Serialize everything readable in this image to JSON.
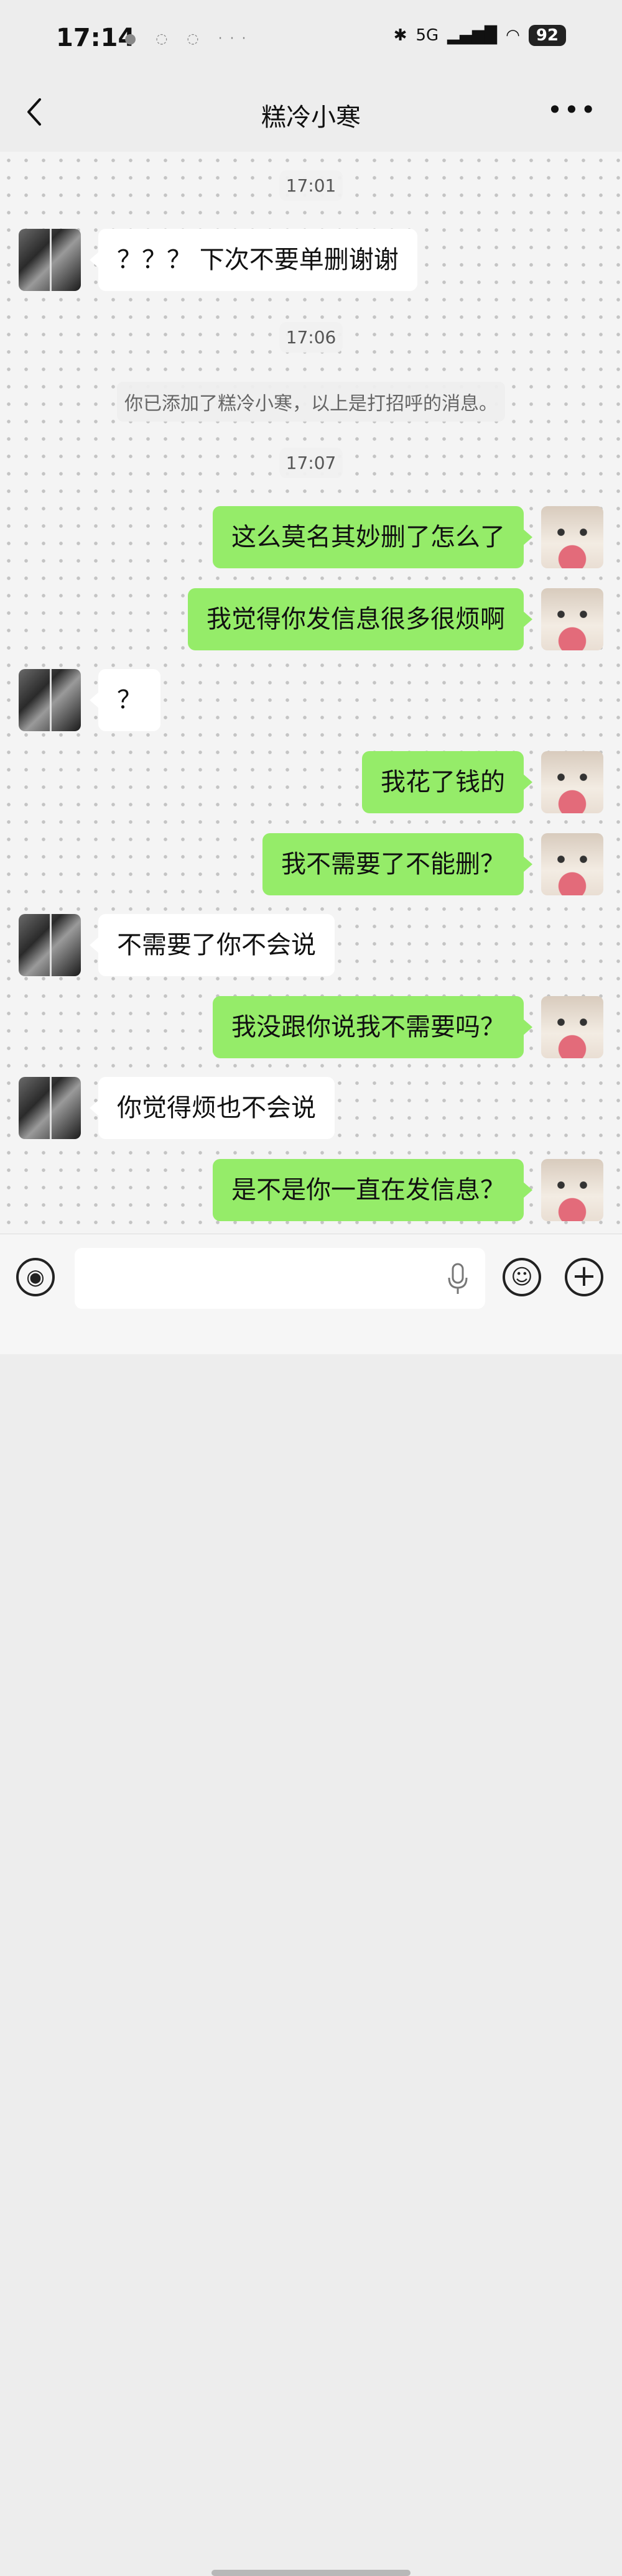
{
  "status_bar": {
    "time": "17:14",
    "network": "5G",
    "battery": "92"
  },
  "header": {
    "title": "糕冷小寒"
  },
  "messages": [
    {
      "type": "timestamp",
      "text": "17:01"
    },
    {
      "type": "peer",
      "text": "？？？ 下次不要单删谢谢"
    },
    {
      "type": "timestamp",
      "text": "17:06"
    },
    {
      "type": "system",
      "text": "你已添加了糕冷小寒，以上是打招呼的消息。"
    },
    {
      "type": "timestamp",
      "text": "17:07"
    },
    {
      "type": "self",
      "text": "这么莫名其妙删了怎么了"
    },
    {
      "type": "self",
      "text": "我觉得你发信息很多很烦啊"
    },
    {
      "type": "peer",
      "text": "？"
    },
    {
      "type": "self",
      "text": "我花了钱的"
    },
    {
      "type": "self",
      "text": "我不需要了不能删？"
    },
    {
      "type": "peer",
      "text": "不需要了你不会说"
    },
    {
      "type": "self",
      "text": "我没跟你说我不需要吗？"
    },
    {
      "type": "peer",
      "text": "你觉得烦也不会说"
    },
    {
      "type": "self",
      "text": "是不是你一直在发信息？"
    }
  ],
  "input": {
    "value": "",
    "placeholder": ""
  },
  "colors": {
    "self_bubble": "#95ec69",
    "peer_bubble": "#ffffff",
    "background": "#ededed"
  }
}
